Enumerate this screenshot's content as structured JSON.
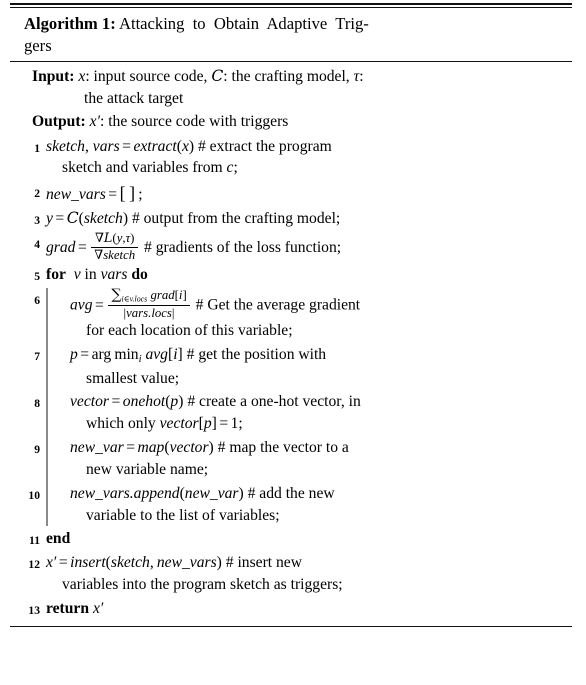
{
  "algorithm": {
    "title": {
      "keyword": "Algorithm",
      "number": "1:",
      "caption": "Attacking to Obtain Adaptive Trig-gers"
    },
    "io": {
      "input_label": "Input:",
      "input_text_1": "x: input source code, C: the crafting model, τ:",
      "input_text_2": "the attack target",
      "output_label": "Output:",
      "output_text": "x′: the source code with triggers"
    },
    "lines": [
      {
        "num": "1",
        "code": "sketch, vars = extract(x)",
        "comment": "# extract the program",
        "cont": "sketch and variables from c;"
      },
      {
        "num": "2",
        "code": "new_vars = [ ] ;",
        "comment": "",
        "cont": ""
      },
      {
        "num": "3",
        "code": "y = C(sketch)",
        "comment": "# output from the crafting model;",
        "cont": ""
      },
      {
        "num": "4",
        "code": "grad = ∇L(y,τ) / ∇sketch",
        "comment": "# gradients of the loss function;",
        "cont": "",
        "fraction": {
          "numerator": "∇L(y,τ)",
          "denominator": "∇sketch"
        }
      },
      {
        "num": "5",
        "code": "for v in vars do",
        "keywords": [
          "for",
          "do"
        ],
        "comment": "",
        "cont": ""
      },
      {
        "num": "6",
        "code": "avg = ∑_{i∈v.locs} grad[i] / |vars.locs|",
        "comment": "# Get the average gradient",
        "cont": "for each location of this variable;",
        "fraction": {
          "numerator": "∑_{i∈v.locs} grad[i]",
          "denominator": "|vars.locs|"
        }
      },
      {
        "num": "7",
        "code": "p = arg min_i avg[i]",
        "comment": "# get the position with",
        "cont": "smallest value;"
      },
      {
        "num": "8",
        "code": "vector = onehot(p)",
        "comment": "# create a one-hot vector, in",
        "cont": "which only vector[p] = 1;"
      },
      {
        "num": "9",
        "code": "new_var = map(vector)",
        "comment": "# map the vector to a",
        "cont": "new variable name;"
      },
      {
        "num": "10",
        "code": "new_vars.append(new_var)",
        "comment": "# add the new",
        "cont": "variable to the list of variables;"
      },
      {
        "num": "11",
        "code": "end",
        "keywords": [
          "end"
        ],
        "comment": "",
        "cont": ""
      },
      {
        "num": "12",
        "code": "x′ = insert(sketch, new_vars)",
        "comment": "# insert new",
        "cont": "variables into the program sketch as triggers;"
      },
      {
        "num": "13",
        "code": "return x′",
        "keywords": [
          "return"
        ],
        "comment": "",
        "cont": ""
      }
    ]
  }
}
